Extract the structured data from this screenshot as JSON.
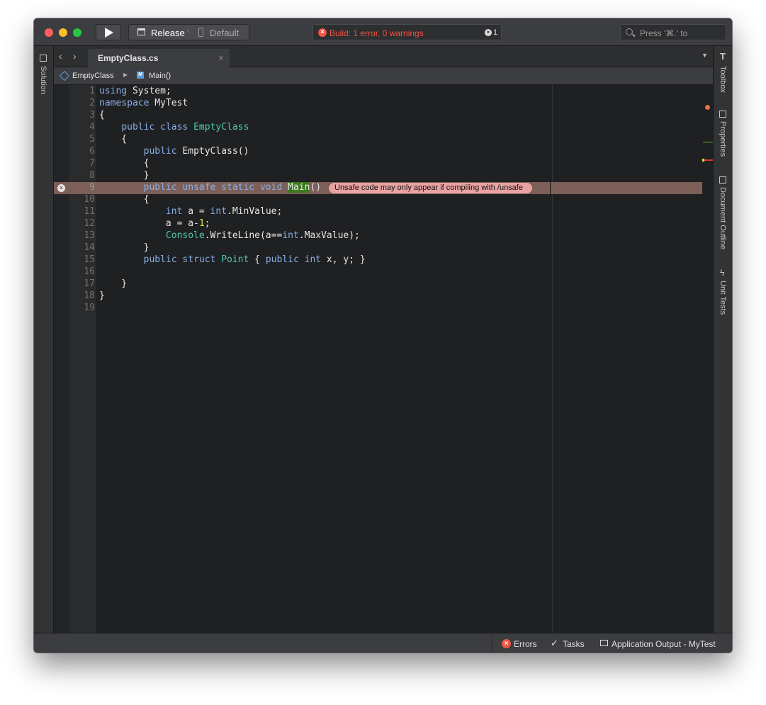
{
  "toolbar": {
    "configuration": "Release",
    "device": "Default",
    "build_status": "Build: 1 error, 0 warnings",
    "error_count": "1",
    "search_placeholder": "Press '⌘.' to"
  },
  "left_pad": {
    "solution_label": "Solution"
  },
  "right_pad": {
    "toolbox_label": "Toolbox",
    "properties_label": "Properties",
    "document_outline_label": "Document Outline",
    "unit_tests_label": "Unit Tests"
  },
  "tabs": [
    {
      "label": "EmptyClass.cs"
    }
  ],
  "breadcrumb": {
    "class_label": "EmptyClass",
    "method_label": "Main()"
  },
  "editor": {
    "line_numbers": [
      "1",
      "2",
      "3",
      "4",
      "5",
      "6",
      "7",
      "8",
      "9",
      "10",
      "11",
      "12",
      "13",
      "14",
      "15",
      "16",
      "17",
      "18",
      "19"
    ],
    "error_line": 9,
    "error_message": "Unsafe code may only appear if compiling with /unsafe",
    "lines": [
      "using System;",
      "namespace MyTest",
      "{",
      "    public class EmptyClass",
      "    {",
      "        public EmptyClass()",
      "        {",
      "        }",
      "        public unsafe static void Main()",
      "        {",
      "            int a = int.MinValue;",
      "            a = a-1;",
      "            Console.WriteLine(a==int.MaxValue);",
      "        }",
      "        public struct Point { public int x, y; }",
      "",
      "    }",
      "}",
      ""
    ]
  },
  "bottom_bar": {
    "errors_label": "Errors",
    "tasks_label": "Tasks",
    "output_label": "Application Output - MyTest"
  },
  "colors": {
    "error": "#ee5544",
    "keyword": "#87afe8",
    "type": "#4ec9b0",
    "error_line_bg": "#7c5f58",
    "error_bubble_bg": "#e9a2a2"
  }
}
